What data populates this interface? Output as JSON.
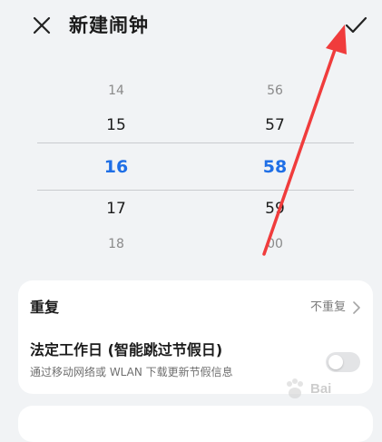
{
  "header": {
    "title": "新建闹钟",
    "close_icon": "close-icon",
    "confirm_icon": "check-icon"
  },
  "picker": {
    "hours": [
      "14",
      "15",
      "16",
      "17",
      "18"
    ],
    "minutes": [
      "56",
      "57",
      "58",
      "59",
      "00"
    ],
    "selected_hour": "16",
    "selected_minute": "58",
    "accent_color": "#1f6fe6"
  },
  "settings": {
    "repeat": {
      "label": "重复",
      "value": "不重复",
      "icon": "chevron-right-icon"
    },
    "workday": {
      "label": "法定工作日 (智能跳过节假日)",
      "description": "通过移动网络或 WLAN 下载更新节假信息",
      "enabled": false
    }
  },
  "annotation": {
    "color": "#f03c3c",
    "icon": "red-arrow-icon"
  },
  "watermark": {
    "text": "Bai"
  }
}
